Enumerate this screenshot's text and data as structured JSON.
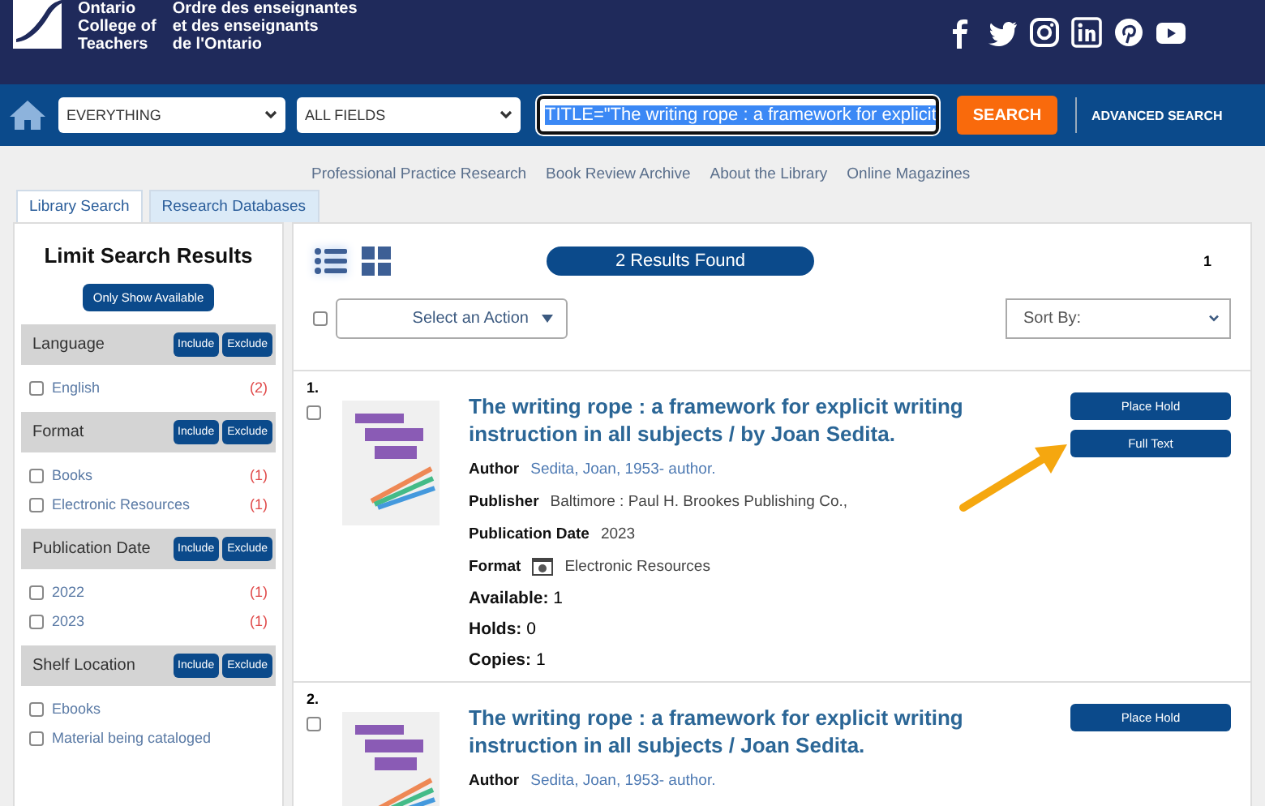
{
  "header": {
    "org_name_en": [
      "Ontario",
      "College of",
      "Teachers"
    ],
    "org_name_fr": [
      "Ordre des enseignantes",
      "et des enseignants",
      "de l'Ontario"
    ]
  },
  "search_bar": {
    "scope": "EVERYTHING",
    "field": "ALL FIELDS",
    "query": "TITLE=\"The writing rope : a framework for explicit",
    "query_selected": true,
    "search_button": "SEARCH",
    "advanced_link": "ADVANCED SEARCH"
  },
  "nav_links": [
    "Professional Practice Research",
    "Book Review Archive",
    "About the Library",
    "Online Magazines"
  ],
  "tabs": [
    {
      "label": "Library Search",
      "selected": true
    },
    {
      "label": "Research Databases",
      "selected": false
    }
  ],
  "sidebar": {
    "title": "Limit Search Results",
    "available_button": "Only Show Available",
    "facets": [
      {
        "name": "Language",
        "include": "Include",
        "exclude": "Exclude",
        "options": [
          {
            "label": "English",
            "count": "(2)",
            "checked": false
          }
        ]
      },
      {
        "name": "Format",
        "include": "Include",
        "exclude": "Exclude",
        "options": [
          {
            "label": "Books",
            "count": "(1)",
            "checked": false
          },
          {
            "label": "Electronic Resources",
            "count": "(1)",
            "checked": false
          }
        ]
      },
      {
        "name": "Publication Date",
        "include": "Include",
        "exclude": "Exclude",
        "options": [
          {
            "label": "2022",
            "count": "(1)",
            "checked": false
          },
          {
            "label": "2023",
            "count": "(1)",
            "checked": false
          }
        ]
      },
      {
        "name": "Shelf Location",
        "include": "Include",
        "exclude": "Exclude",
        "options": [
          {
            "label": "Ebooks",
            "checked": false
          },
          {
            "label": "Material being cataloged",
            "checked": false
          }
        ]
      }
    ]
  },
  "toolbar": {
    "views": [
      {
        "kind": "list",
        "selected": true
      },
      {
        "kind": "grid",
        "selected": false
      }
    ],
    "results_count": "2 Results Found",
    "page": "1",
    "select_all_checked": false,
    "action_placeholder": "Select an Action",
    "sort_placeholder": "Sort By:"
  },
  "results": [
    {
      "number": "1.",
      "checked": false,
      "title": "The writing rope : a framework for explicit writing instruction in all subjects / by Joan Sedita.",
      "fields": [
        {
          "label": "Author",
          "value": "Sedita, Joan, 1953- author.",
          "kind": "link"
        },
        {
          "label": "Publisher",
          "value": "Baltimore : Paul H. Brookes Publishing Co.,",
          "kind": "text"
        },
        {
          "label": "Publication Date",
          "value": "2023",
          "kind": "text"
        },
        {
          "label": "Format",
          "value": "Electronic Resources",
          "kind": "format"
        }
      ],
      "counts": [
        {
          "label": "Available:",
          "value": "1"
        },
        {
          "label": "Holds:",
          "value": "0"
        },
        {
          "label": "Copies:",
          "value": "1"
        }
      ],
      "buttons": [
        "Place Hold",
        "Full Text"
      ]
    },
    {
      "number": "2.",
      "checked": false,
      "title": "The writing rope : a framework for explicit writing instruction in all subjects / Joan Sedita.",
      "fields": [
        {
          "label": "Author",
          "value": "Sedita, Joan, 1953- author.",
          "kind": "link"
        }
      ],
      "buttons": [
        "Place Hold"
      ]
    }
  ]
}
